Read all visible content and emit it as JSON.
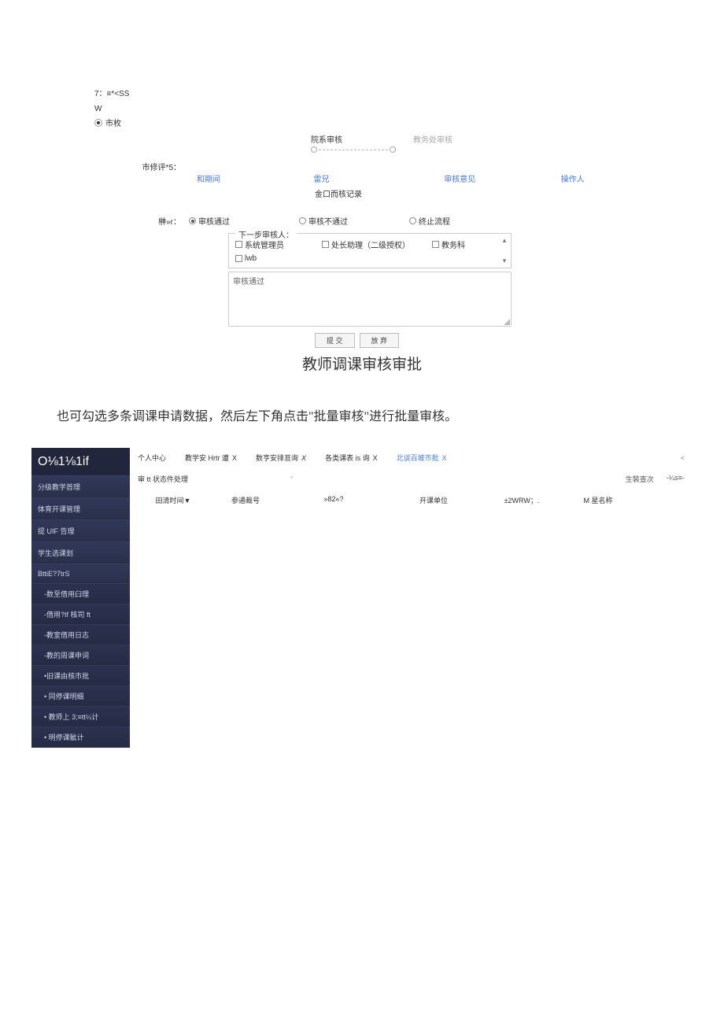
{
  "top": {
    "line1": "7：≡*<SS",
    "line2": "W",
    "radio1_label": "市枚",
    "progress_step1": "院系审核",
    "progress_step2": "教务处审核",
    "row2_label": "市修评*5：",
    "headers": {
      "c1": "和期间",
      "c2": "雷兄",
      "c3": "审核意见",
      "c4": "操作人"
    },
    "no_records": "金口而核记录",
    "row3_label": "榊»r：",
    "decisions": {
      "pass": "审核通过",
      "fail": "审核不通过",
      "stop": "终止流程"
    },
    "fieldset_title": "下一步审核人：",
    "reviewers": {
      "r1": "系统管理员",
      "r2": "处长助理（二级授权）",
      "r3": "教务科",
      "r4": "lwb"
    },
    "textarea_placeholder": "审核通过",
    "btn_submit": "提 交",
    "btn_reset": "放 弃"
  },
  "big_title": "教师调课审核审批",
  "desc": "也可勾选多条调课申请数据，然后左下角点击\"批量审核\"进行批量审核。",
  "sidebar": {
    "logo": "O⅛1⅛1if",
    "items": [
      "分级教学首理",
      "体育开课管理",
      "提 UIF 告理",
      "学生选课划",
      "BttiE?7trS"
    ],
    "subs": [
      "-数至借用臼理",
      "-借用?If 核司 ft",
      "-教室借用日志",
      "-教的周课申词",
      "•旧课由核市批",
      "• 同停课明细",
      "• 教师上 3;≡tt¼计",
      "• 明停课骴计"
    ]
  },
  "tabs": {
    "t1": "个人中心",
    "t2": "教学安 Hrtr 遭",
    "t3": "数亨安排亘询",
    "t4": "各类课表 is 询",
    "t5": "北谈百坡市批",
    "close": "X",
    "arrow": "<"
  },
  "status": {
    "label": "审 tt 状态件处理",
    "quote": "\"",
    "action1": "生裝查次",
    "action2": "-¼s≡-"
  },
  "table": {
    "c1": "田清时间▼",
    "c2": "参通裁号",
    "c3": "»82«?",
    "c4": "开课单位",
    "c5": "±2WRW；.",
    "c6": "M 星名称"
  }
}
